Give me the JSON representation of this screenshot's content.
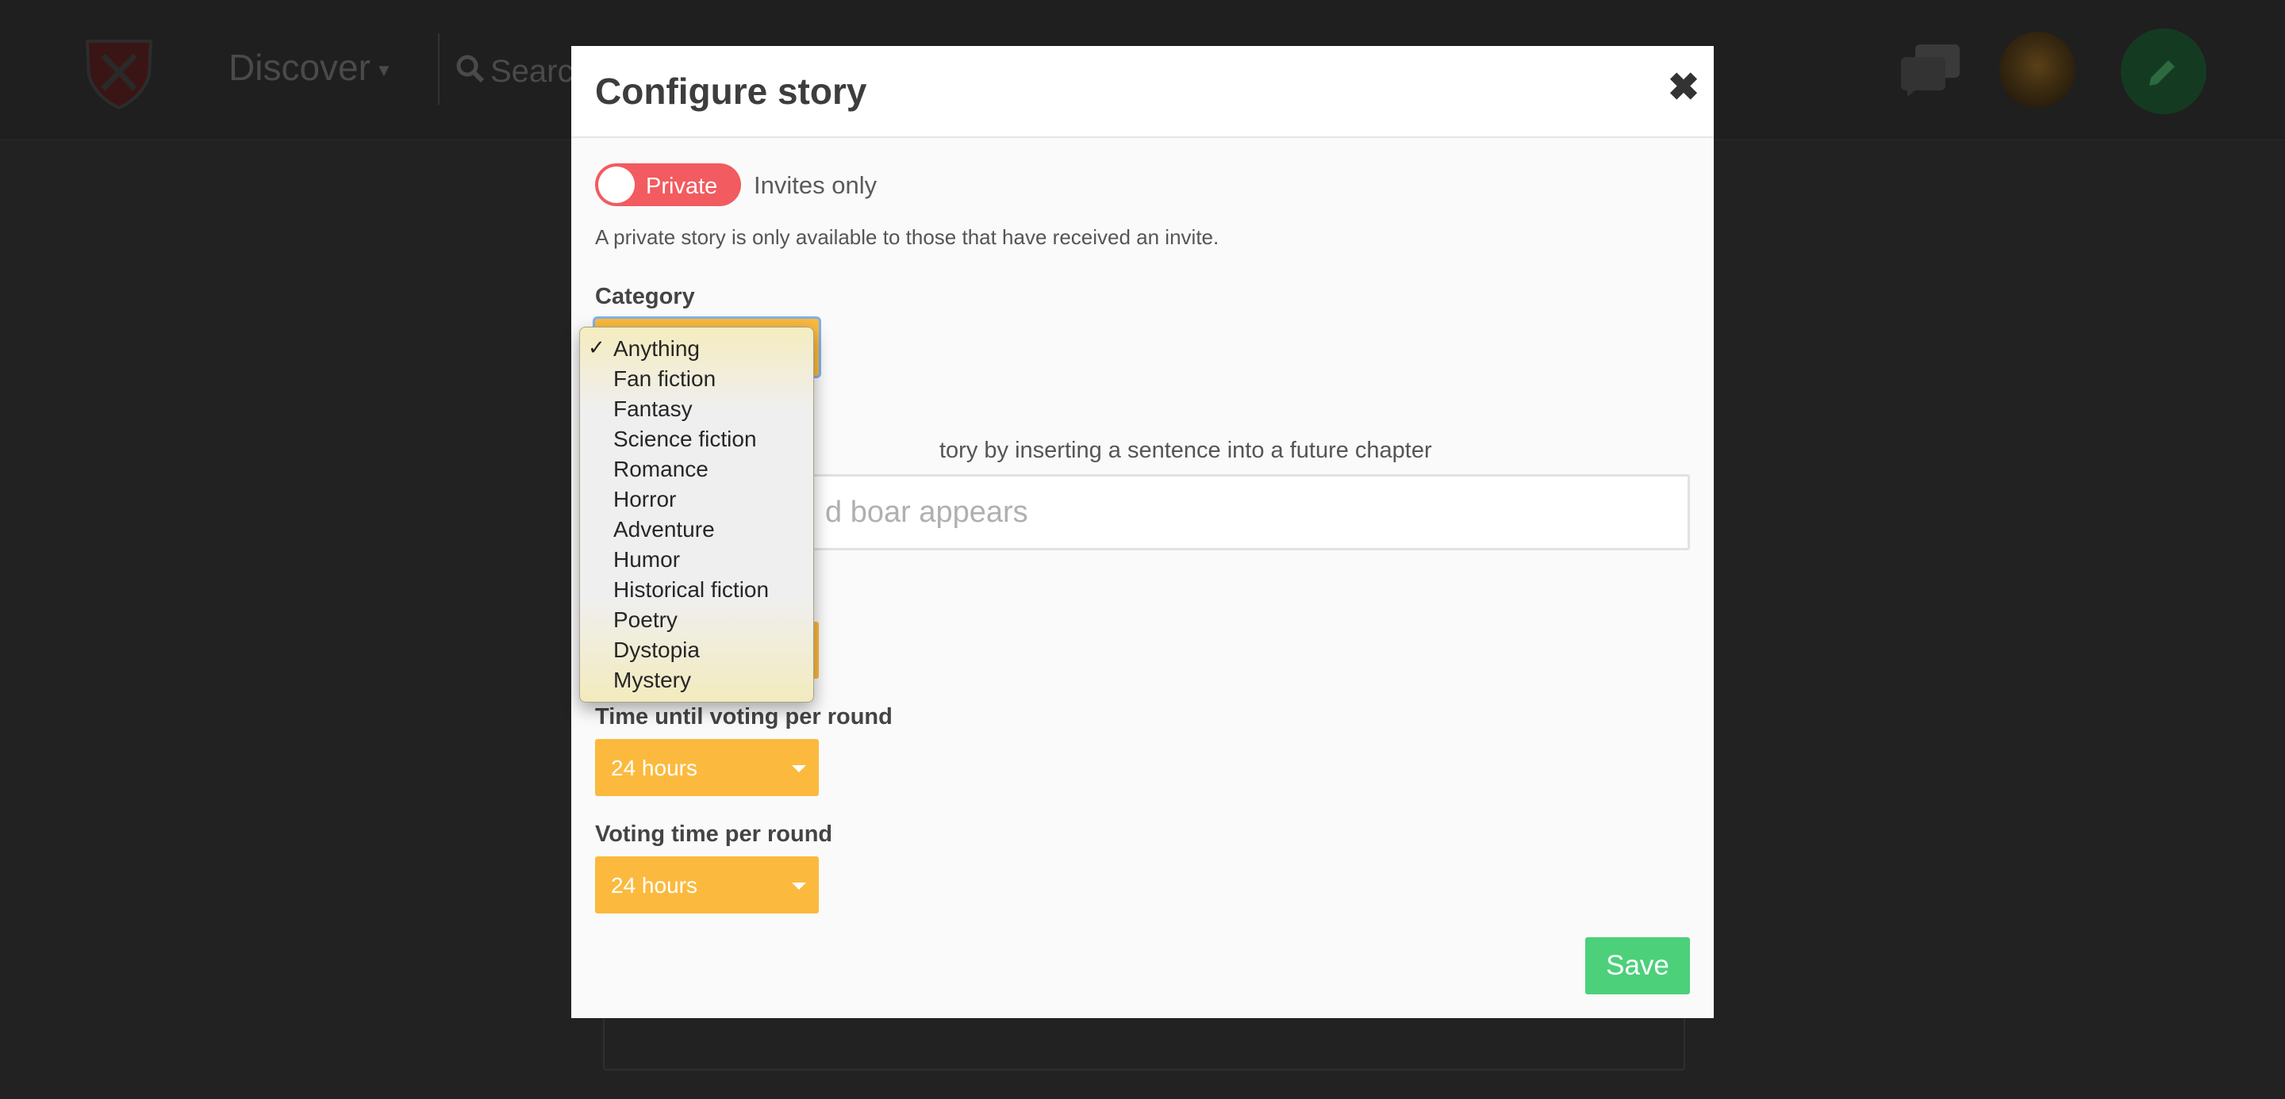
{
  "background": {
    "nav_discover": "Discover",
    "search_placeholder": "Search"
  },
  "modal": {
    "title": "Configure story",
    "close_glyph": "✖",
    "privacy_toggle_label": "Private",
    "privacy_toggle_on": true,
    "invites_label": "Invites only",
    "privacy_note": "A private story is only available to those that have received an invite.",
    "category_label": "Category",
    "twist_note_visible": "tory by inserting a sentence into a future chapter",
    "twist_placeholder_visible": "d boar appears",
    "time_until_voting_label": "Time until voting per round",
    "time_until_voting_value": "24 hours",
    "voting_time_label": "Voting time per round",
    "voting_time_value": "24 hours",
    "save_label": "Save"
  },
  "category_dropdown": {
    "selected": "Anything",
    "check_glyph": "✓",
    "options": [
      "Anything",
      "Fan fiction",
      "Fantasy",
      "Science fiction",
      "Romance",
      "Horror",
      "Adventure",
      "Humor",
      "Historical fiction",
      "Poetry",
      "Dystopia",
      "Mystery"
    ]
  },
  "colors": {
    "toggle_on": "#f25b5f",
    "select_bg": "#fbba3e",
    "save_bg": "#4cd07a",
    "backdrop": "#222222"
  },
  "icons": [
    "shield-logo-icon",
    "search-icon",
    "chat-icon",
    "pencil-icon",
    "close-icon",
    "chevron-down-icon"
  ]
}
